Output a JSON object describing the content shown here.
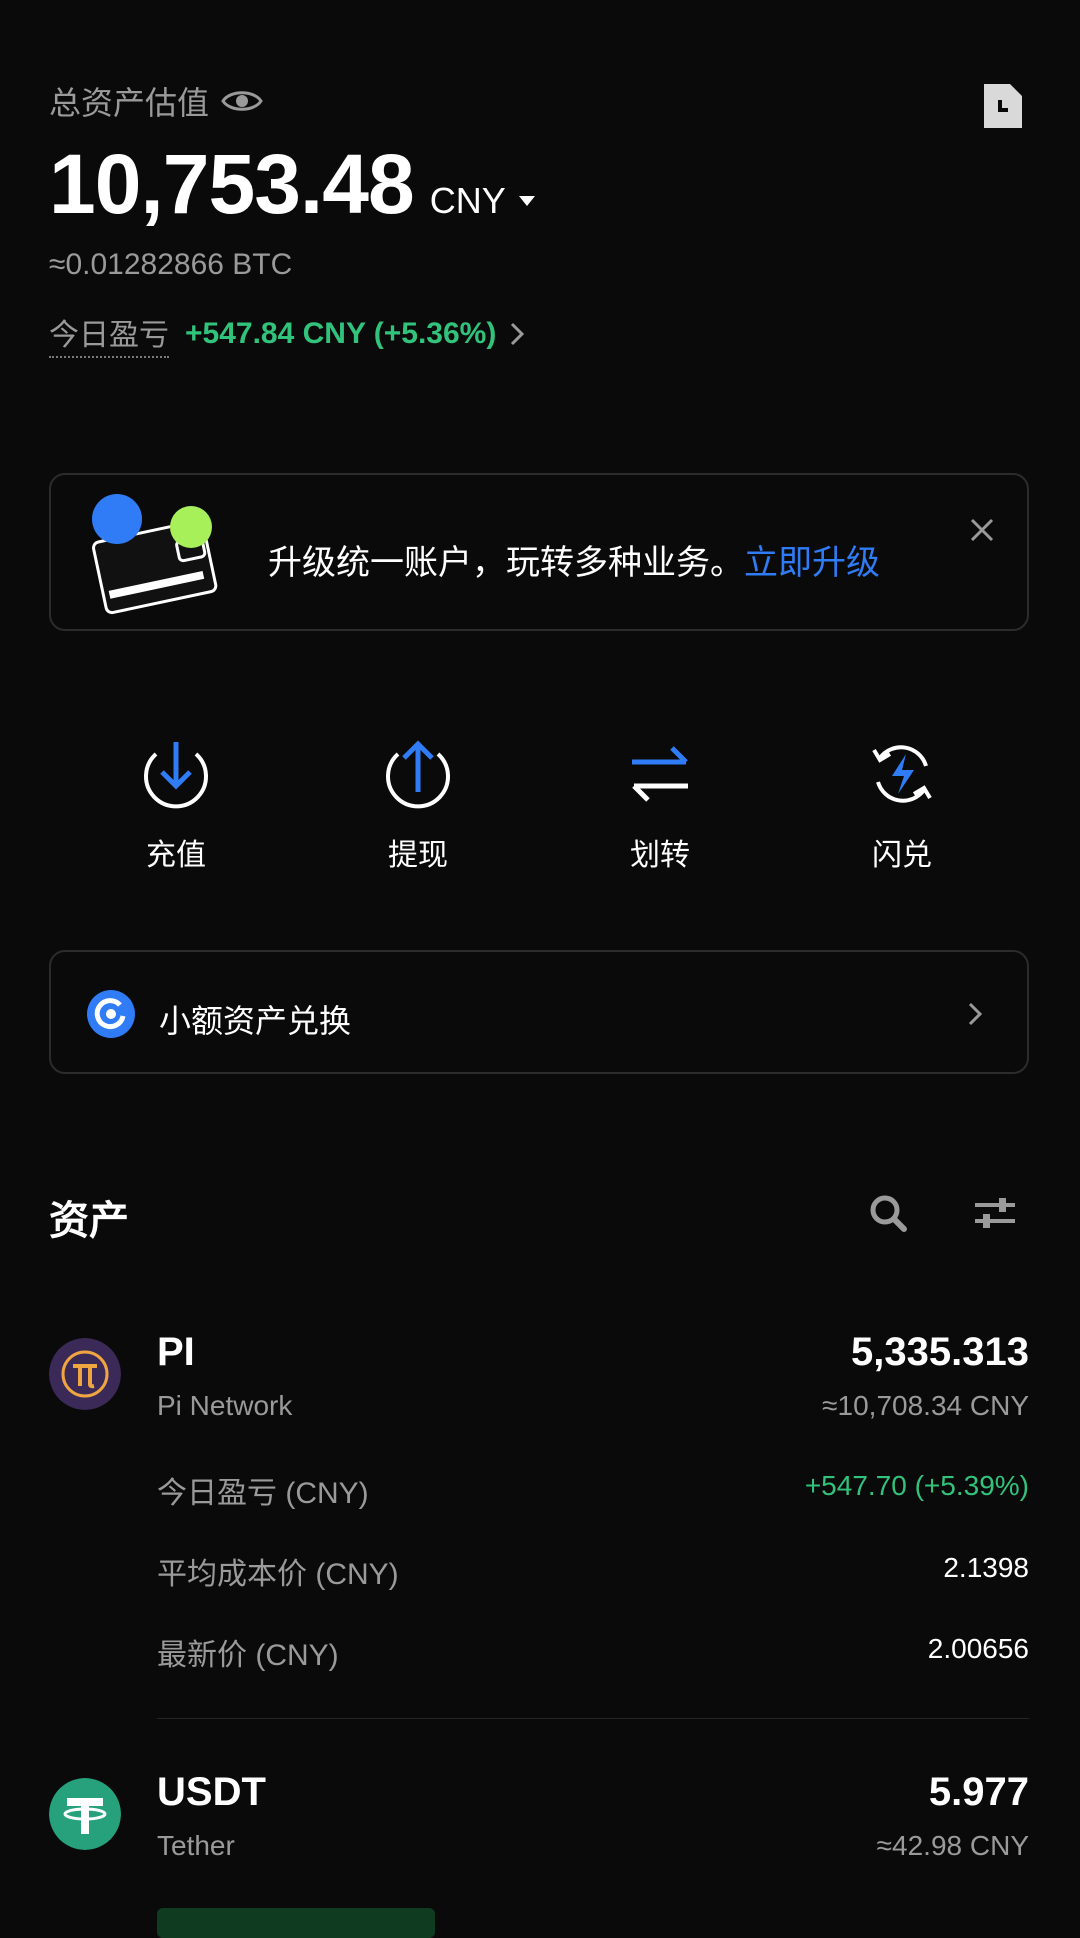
{
  "header": {
    "total_label": "总资产估值",
    "balance": "10,753.48",
    "currency": "CNY",
    "btc_equivalent": "≈0.01282866 BTC",
    "today_pnl_label": "今日盈亏",
    "today_pnl_value": "+547.84 CNY (+5.36%)"
  },
  "banner": {
    "text": "升级统一账户，玩转多种业务。",
    "link": "立即升级"
  },
  "actions": [
    {
      "label": "充值",
      "icon": "deposit-icon"
    },
    {
      "label": "提现",
      "icon": "withdraw-icon"
    },
    {
      "label": "划转",
      "icon": "transfer-icon"
    },
    {
      "label": "闪兑",
      "icon": "flash-convert-icon"
    }
  ],
  "small_assets": {
    "label": "小额资产兑换"
  },
  "assets": {
    "title": "资产",
    "items": [
      {
        "symbol": "PI",
        "name": "Pi Network",
        "amount": "5,335.313",
        "cny_value": "≈10,708.34 CNY",
        "details": [
          {
            "label": "今日盈亏 (CNY)",
            "value": "+547.70 (+5.39%)"
          },
          {
            "label": "平均成本价 (CNY)",
            "value": "2.1398"
          },
          {
            "label": "最新价 (CNY)",
            "value": "2.00656"
          }
        ]
      },
      {
        "symbol": "USDT",
        "name": "Tether",
        "amount": "5.977",
        "cny_value": "≈42.98 CNY"
      }
    ]
  },
  "colors": {
    "background": "#0a0a0a",
    "positive": "#31c27c",
    "accent_blue": "#2f7cf6",
    "muted_text": "#9a9a9a"
  }
}
